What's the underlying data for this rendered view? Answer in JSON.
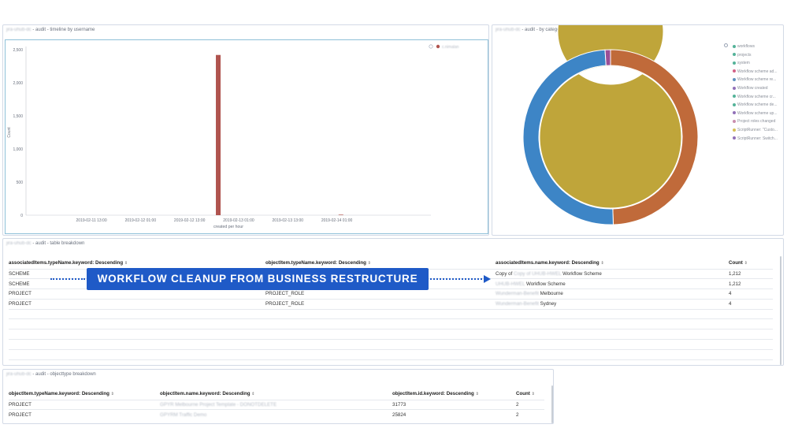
{
  "panels": {
    "timeline": {
      "owner": "jira-uhub-dc",
      "title": " - audit - timeline by username"
    },
    "category": {
      "owner": "jira-uhub-dc",
      "title": " - audit - by category"
    },
    "table": {
      "owner": "jira-uhub-dc",
      "title": " - audit - table breakdown"
    },
    "objecttype": {
      "owner": "jira-uhub-dc",
      "title": " - audit - objecttype breakdown"
    }
  },
  "banner": {
    "text": "WORKFLOW CLEANUP FROM BUSINESS RESTRUCTURE"
  },
  "chart_data": [
    {
      "type": "bar",
      "title": "",
      "ylabel": "Count",
      "xlabel": "created per hour",
      "ylim": [
        0,
        2500
      ],
      "yticks": [
        "0",
        "500",
        "1,000",
        "1,500",
        "2,000",
        "2,500"
      ],
      "xticks": [
        "2019-02-11 13:00",
        "2019-02-12 01:00",
        "2019-02-12 13:00",
        "2019-02-13 01:00",
        "2019-02-13 13:00",
        "2019-02-14 01:00"
      ],
      "series": [
        {
          "name": "c.nimalan",
          "color": "#b0544f",
          "points": [
            {
              "x": "2019-02-12 20:00",
              "y": 2420
            },
            {
              "x": "2019-02-14 02:00",
              "y": 8
            }
          ]
        }
      ],
      "legend": "top-right"
    },
    {
      "type": "pie",
      "title": "",
      "rings": [
        {
          "name": "inner",
          "slices": [
            {
              "label": "workflows",
              "value": 100,
              "color": "#bfa53a"
            }
          ]
        },
        {
          "name": "outer",
          "slices": [
            {
              "label": "Workflow scheme added",
              "value": 49.5,
              "color": "#c06a3a"
            },
            {
              "label": "Workflow scheme removed",
              "value": 49.5,
              "color": "#3d85c6"
            },
            {
              "label": "Project roles changed",
              "value": 1,
              "color": "#9b4f96"
            }
          ]
        }
      ],
      "legend_items": [
        {
          "label": "workflows",
          "color": "#54b399"
        },
        {
          "label": "projects",
          "color": "#54b399"
        },
        {
          "label": "system",
          "color": "#54b399"
        },
        {
          "label": "Workflow scheme ad...",
          "color": "#d36086"
        },
        {
          "label": "Workflow scheme re...",
          "color": "#6092c0"
        },
        {
          "label": "Workflow created",
          "color": "#9170b8"
        },
        {
          "label": "Workflow scheme cr...",
          "color": "#54b399"
        },
        {
          "label": "Workflow scheme de...",
          "color": "#54b399"
        },
        {
          "label": "Workflow scheme up...",
          "color": "#9170b8"
        },
        {
          "label": "Project roles changed",
          "color": "#ca8eae"
        },
        {
          "label": "ScriptRunner: \"Custo...",
          "color": "#d6bf57"
        },
        {
          "label": "ScriptRunner: Switch...",
          "color": "#9170b8"
        }
      ],
      "legend": "right"
    }
  ],
  "table_breakdown": {
    "headers": [
      "associatedItems.typeName.keyword: Descending",
      "objectItem.typeName.keyword: Descending",
      "associatedItems.name.keyword: Descending",
      "Count"
    ],
    "rows": [
      {
        "c1": "SCHEME",
        "c2": "",
        "c3_hidden": "Copy of UHUB-HWEL",
        "c3": " Workflow Scheme",
        "c3_prefix": "Copy of ",
        "c4": "1,212"
      },
      {
        "c1": "SCHEME",
        "c2": "",
        "c3_hidden": "UHUB-HWEL",
        "c3": " Workflow Scheme",
        "c3_prefix": "",
        "c4": "1,212"
      },
      {
        "c1": "PROJECT",
        "c2": "PROJECT_ROLE",
        "c3_hidden": "Wunderman-Benefit",
        "c3": " Melbourne",
        "c3_prefix": "",
        "c4": "4"
      },
      {
        "c1": "PROJECT",
        "c2": "PROJECT_ROLE",
        "c3_hidden": "Wunderman-Benefit",
        "c3": " Sydney",
        "c3_prefix": "",
        "c4": "4"
      }
    ]
  },
  "objecttype_breakdown": {
    "headers": [
      "objectItem.typeName.keyword: Descending",
      "objectItem.name.keyword: Descending",
      "objectItem.id.keyword: Descending",
      "Count"
    ],
    "rows": [
      {
        "c1": "PROJECT",
        "c2": "GPYR Melbourne Project Template - DONOTDELETE",
        "c3": "31773",
        "c4": "2"
      },
      {
        "c1": "PROJECT",
        "c2": "GPYRM Traffic Demo",
        "c3": "25824",
        "c4": "2"
      }
    ]
  },
  "sort_glyph": "⇕"
}
